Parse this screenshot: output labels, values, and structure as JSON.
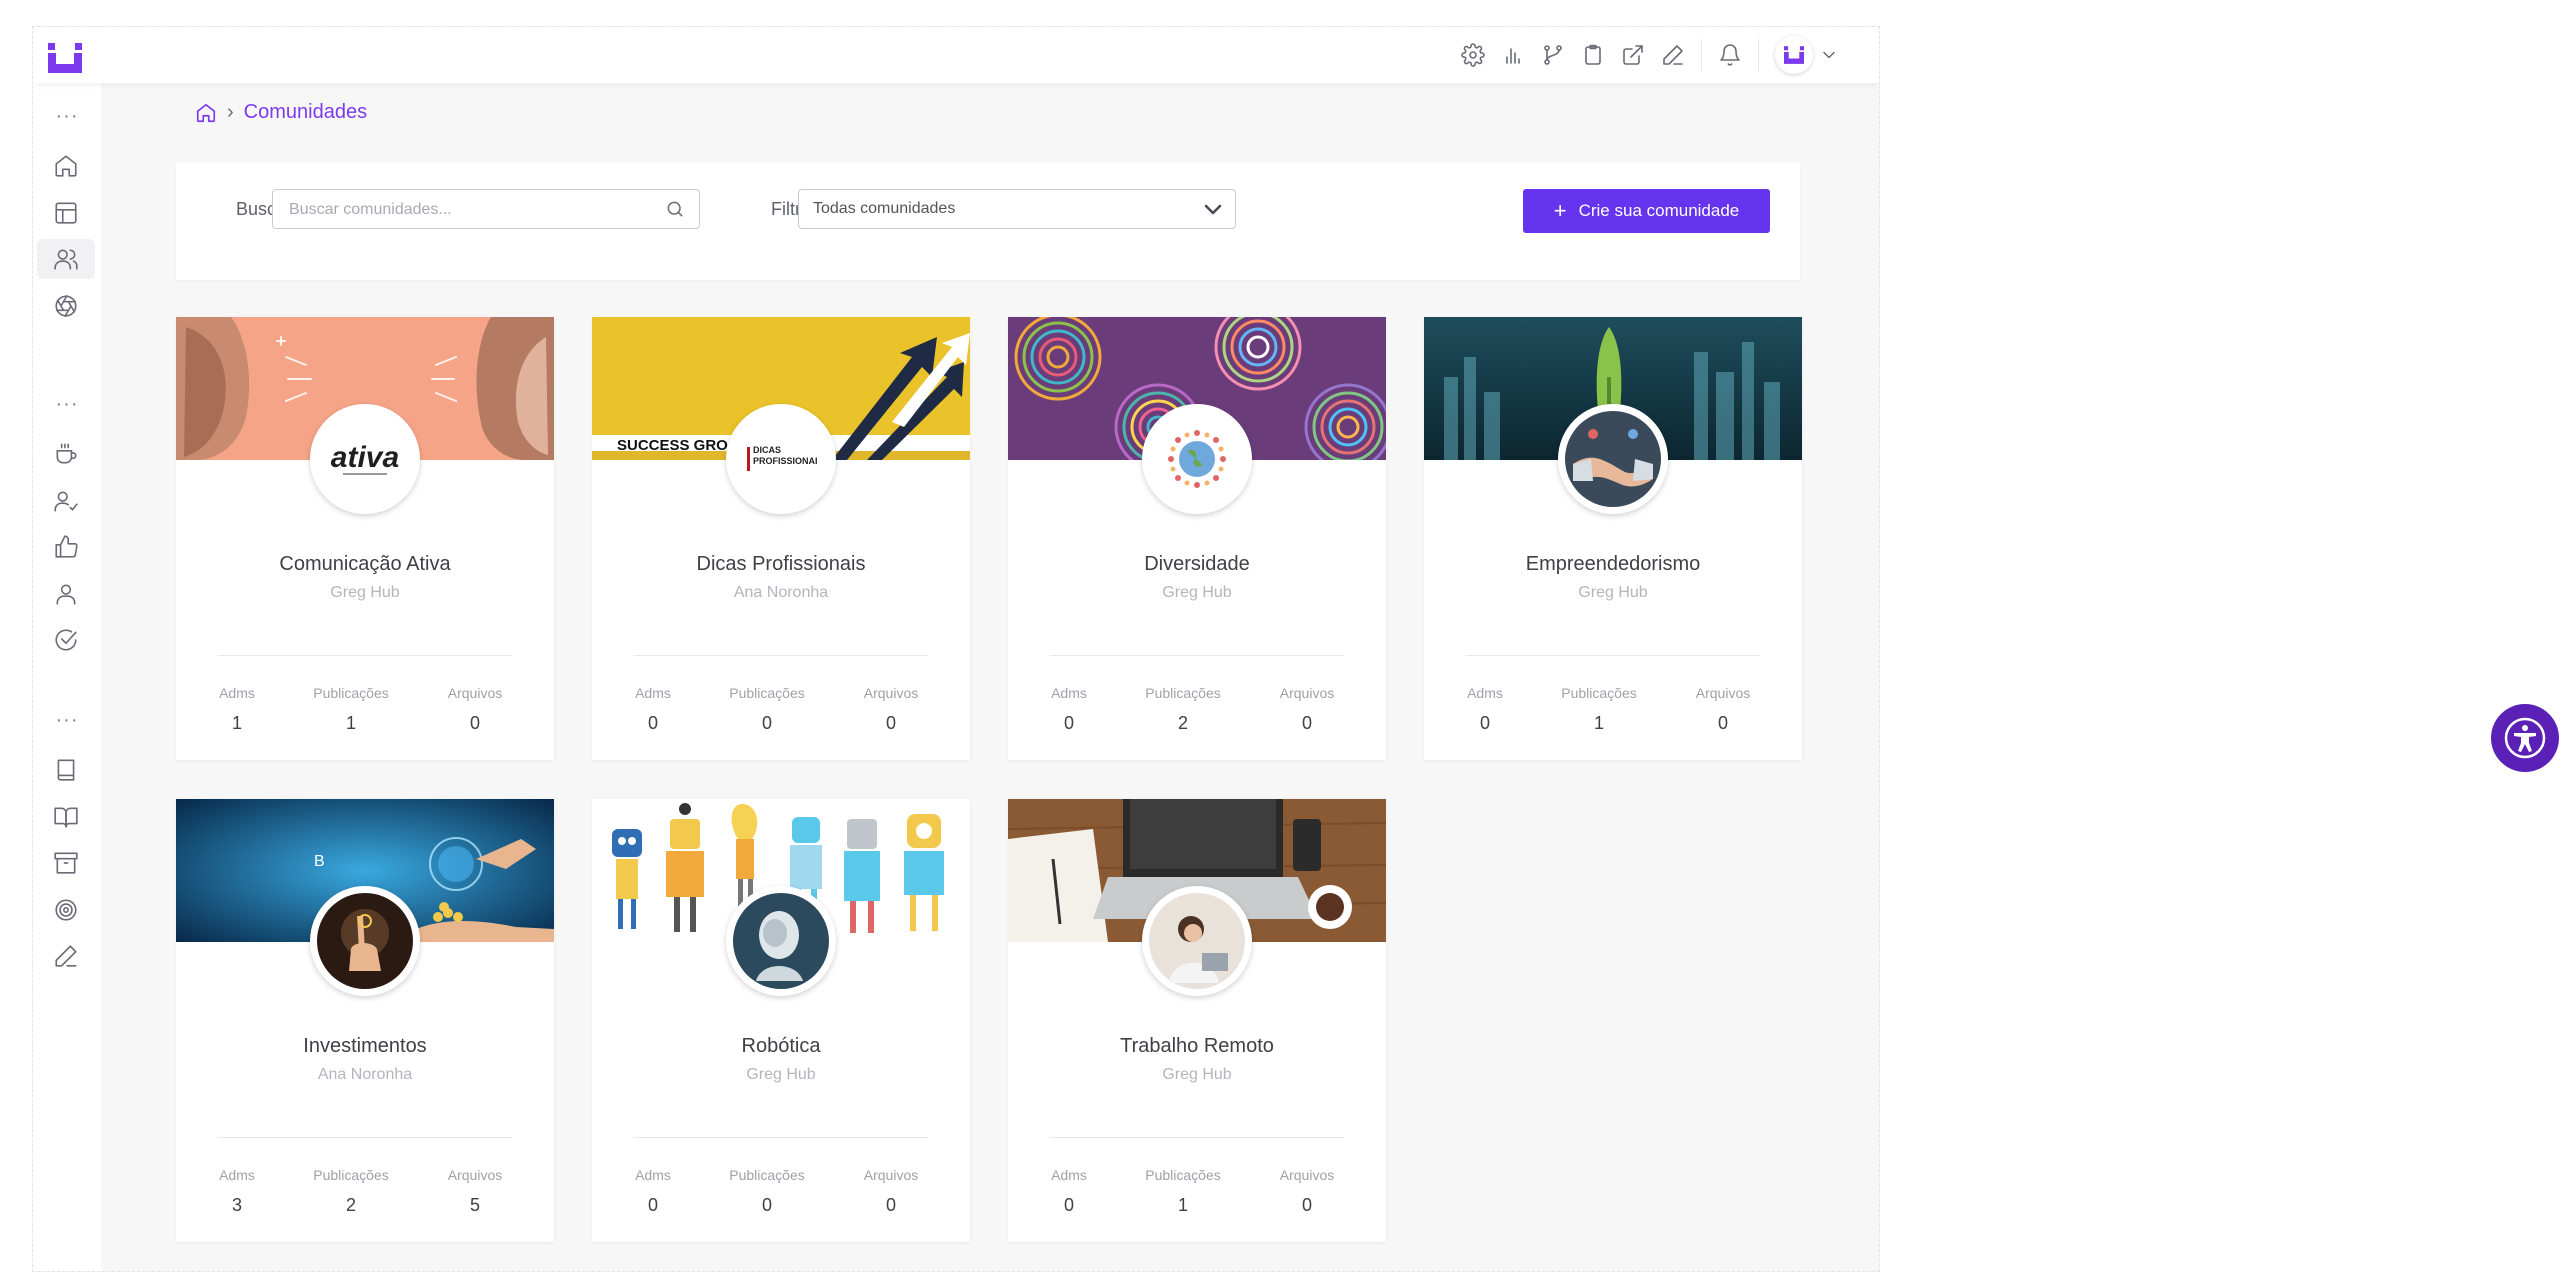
{
  "brand": {
    "accent": "#6633ee",
    "breadcrumb_color": "#7c3aed"
  },
  "topbar": {
    "icons": [
      "gear-icon",
      "bar-chart-icon",
      "git-branch-icon",
      "clipboard-icon",
      "external-link-icon",
      "pen-icon",
      "bell-icon"
    ],
    "user_menu_icon": "chevron-down-icon"
  },
  "sidebar": {
    "groups": [
      [
        "home-icon",
        "layout-icon",
        "users-icon",
        "aperture-icon"
      ],
      [
        "coffee-cup-icon",
        "user-check-icon",
        "thumbs-up-icon",
        "user-icon",
        "check-circle-icon"
      ],
      [
        "book-icon",
        "book-open-icon",
        "archive-icon",
        "target-icon",
        "pen-icon"
      ]
    ],
    "active": "users-icon"
  },
  "breadcrumb": {
    "current": "Comunidades"
  },
  "search": {
    "label": "Buscar",
    "placeholder": "Buscar comunidades...",
    "filter_label": "Filtrar",
    "filter_value": "Todas comunidades",
    "create_label": "Crie sua comunidade"
  },
  "stat_labels": {
    "adms": "Adms",
    "posts": "Publicações",
    "files": "Arquivos"
  },
  "communities": [
    {
      "name": "Comunicação Ativa",
      "owner": "Greg Hub",
      "adms": "1",
      "posts": "1",
      "files": "0",
      "cover_text": "",
      "emblem_text": "ativa"
    },
    {
      "name": "Dicas Profissionais",
      "owner": "Ana Noronha",
      "adms": "0",
      "posts": "0",
      "files": "0",
      "cover_text": "SUCCESS GRO",
      "emblem_text": "DICAS PROFISSIONAIS"
    },
    {
      "name": "Diversidade",
      "owner": "Greg Hub",
      "adms": "0",
      "posts": "2",
      "files": "0",
      "cover_text": "",
      "emblem_text": ""
    },
    {
      "name": "Empreendedorismo",
      "owner": "Greg Hub",
      "adms": "0",
      "posts": "1",
      "files": "0",
      "cover_text": "",
      "emblem_text": ""
    },
    {
      "name": "Investimentos",
      "owner": "Ana Noronha",
      "adms": "3",
      "posts": "2",
      "files": "5",
      "cover_text": "B",
      "emblem_text": ""
    },
    {
      "name": "Robótica",
      "owner": "Greg Hub",
      "adms": "0",
      "posts": "0",
      "files": "0",
      "cover_text": "",
      "emblem_text": ""
    },
    {
      "name": "Trabalho Remoto",
      "owner": "Greg Hub",
      "adms": "0",
      "posts": "1",
      "files": "0",
      "cover_text": "",
      "emblem_text": ""
    }
  ],
  "accessibility": {
    "icon": "accessibility-icon"
  }
}
